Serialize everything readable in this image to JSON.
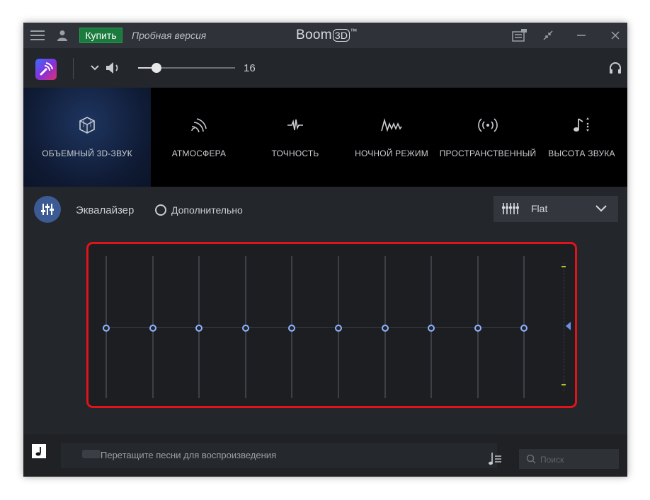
{
  "titlebar": {
    "buy_label": "Купить",
    "trial_label": "Пробная версия",
    "app_name": "Boom",
    "app_suffix": "3D",
    "trademark": "™",
    "icons": [
      "menu-icon",
      "user-icon",
      "notes-icon",
      "shrink-icon",
      "minimize-icon",
      "close-icon"
    ]
  },
  "toolbar": {
    "volume_value": "16",
    "volume_level": 0.19,
    "icons": [
      "boom-logo-icon",
      "chevron-down-icon",
      "speaker-icon",
      "headphones-icon"
    ]
  },
  "modes": [
    {
      "label": "ОБЪЕМНЫЙ 3D-ЗВУК",
      "icon": "cube-icon",
      "active": true
    },
    {
      "label": "АТМОСФЕРА",
      "icon": "waves-icon",
      "active": false
    },
    {
      "label": "ТОЧНОСТЬ",
      "icon": "pulse-icon",
      "active": false
    },
    {
      "label": "НОЧНОЙ РЕЖИМ",
      "icon": "wave-icon",
      "active": false
    },
    {
      "label": "ПРОСТРАНСТВЕННЫЙ",
      "icon": "broadcast-icon",
      "active": false
    },
    {
      "label": "ВЫСОТА ЗВУКА",
      "icon": "pitch-note-icon",
      "active": false
    }
  ],
  "equalizer": {
    "title": "Эквалайзер",
    "advanced_label": "Дополнительно",
    "preset": "Flat",
    "bands": [
      0,
      0,
      0,
      0,
      0,
      0,
      0,
      0,
      0,
      0
    ],
    "highlight_color": "#e0141a",
    "knob_color": "#8fb2ff"
  },
  "bottombar": {
    "drop_hint": "Перетащите песни для воспроизведения",
    "search_placeholder": "Поиск"
  },
  "colors": {
    "buy_button": "#1b7a3d",
    "active_mode": "#1e3560",
    "background": "#23262b"
  }
}
